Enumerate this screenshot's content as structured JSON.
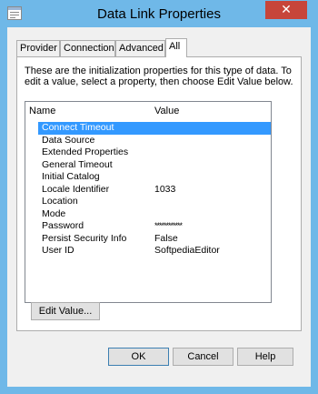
{
  "window": {
    "title": "Data Link Properties",
    "close_glyph": "✕",
    "icon": "data-link-icon"
  },
  "tabs": [
    {
      "label": "Provider"
    },
    {
      "label": "Connection"
    },
    {
      "label": "Advanced"
    },
    {
      "label": "All"
    }
  ],
  "intro_text": "These are the initialization properties for this type of data. To edit a value, select a property, then choose Edit Value below.",
  "list": {
    "columns": {
      "name": "Name",
      "value": "Value"
    },
    "rows": [
      {
        "name": "Connect Timeout",
        "value": ""
      },
      {
        "name": "Data Source",
        "value": ""
      },
      {
        "name": "Extended Properties",
        "value": ""
      },
      {
        "name": "General Timeout",
        "value": ""
      },
      {
        "name": "Initial Catalog",
        "value": ""
      },
      {
        "name": "Locale Identifier",
        "value": "1033"
      },
      {
        "name": "Location",
        "value": ""
      },
      {
        "name": "Mode",
        "value": ""
      },
      {
        "name": "Password",
        "value": "************"
      },
      {
        "name": "Persist Security Info",
        "value": "False"
      },
      {
        "name": "User ID",
        "value": "SoftpediaEditor"
      }
    ]
  },
  "buttons": {
    "edit_value": "Edit Value...",
    "ok": "OK",
    "cancel": "Cancel",
    "help": "Help"
  },
  "colors": {
    "frame": "#6fb8e8",
    "close": "#c7453a",
    "selection": "#3399ff"
  }
}
